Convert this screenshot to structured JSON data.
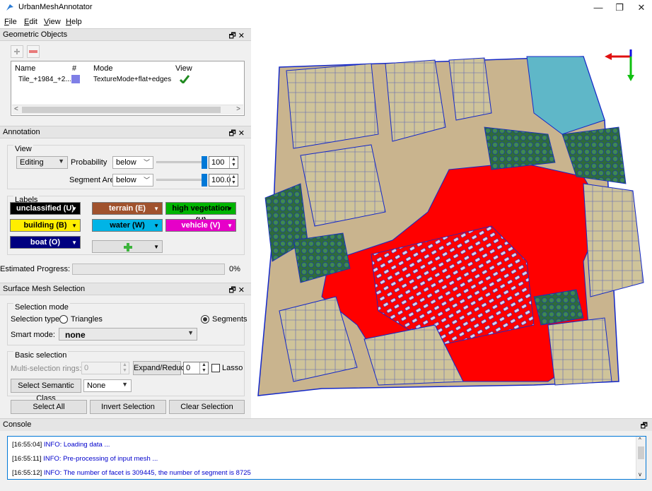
{
  "app": {
    "title": "UrbanMeshAnnotator"
  },
  "window_buttons": {
    "minimize": "—",
    "restore": "❐",
    "close": "✕"
  },
  "menu": [
    {
      "key": "F",
      "rest": "ile"
    },
    {
      "key": "E",
      "rest": "dit"
    },
    {
      "key": "V",
      "rest": "iew"
    },
    {
      "key": "H",
      "rest": "elp"
    }
  ],
  "dock_buttons": "🗗✕",
  "geometric_objects": {
    "title": "Geometric Objects",
    "columns": [
      "Name",
      "#",
      "Mode",
      "View"
    ],
    "row": {
      "name": "Tile_+1984_+2...",
      "color": "#7f7fe6",
      "mode": "TextureMode+flat+edges",
      "view_icon": "checkmark-icon"
    },
    "scroll_left": "<",
    "scroll_right": ">"
  },
  "annotation": {
    "title": "Annotation",
    "view_group": "View",
    "mode": "Editing",
    "probability_label": "Probability",
    "probability_op": "below",
    "probability_value": "100",
    "probability_slider": 1.0,
    "segment_area_label": "Segment Area",
    "segment_area_op": "below",
    "segment_area_value": "100.0",
    "segment_area_slider": 1.0,
    "labels_group": "Labels",
    "labels": [
      {
        "text": "unclassified (U)",
        "bg": "#000000",
        "fg": "#ffffff"
      },
      {
        "text": "terrain (E)",
        "bg": "#a0522d",
        "fg": "#ffffff"
      },
      {
        "text": "high vegetation (H)",
        "bg": "#00b400",
        "fg": "#000000"
      },
      {
        "text": "building (B)",
        "bg": "#ffee00",
        "fg": "#000000"
      },
      {
        "text": "water (W)",
        "bg": "#00b4e6",
        "fg": "#000000"
      },
      {
        "text": "vehicle (V)",
        "bg": "#e600c8",
        "fg": "#ffffff"
      },
      {
        "text": "boat (O)",
        "bg": "#000080",
        "fg": "#ffffff"
      }
    ],
    "add_label_icon": "plus-icon",
    "progress_label": "Estimated Progress:",
    "progress_value": 0,
    "progress_text": "0%"
  },
  "surface_selection": {
    "title": "Surface Mesh Selection",
    "selection_mode_group": "Selection mode",
    "selection_type_label": "Selection type:",
    "triangles": "Triangles",
    "segments": "Segments",
    "smart_mode_label": "Smart mode:",
    "smart_mode_value": "none",
    "basic_group": "Basic selection",
    "multi_rings_label": "Multi-selection rings:",
    "multi_rings_value": "0",
    "expand_reduce": "Expand/Reduce",
    "expand_value": "0",
    "lasso": "Lasso",
    "select_semantic_class": "Select Semantic Class",
    "semantic_value": "None",
    "select_all": "Select All",
    "select_all_mnemonic": "A",
    "invert_selection": "Invert Selection",
    "clear_selection": "Clear Selection"
  },
  "console": {
    "title": "Console",
    "lines": [
      {
        "ts": "[16:55:04]",
        "msg": " INFO: Loading data ..."
      },
      {
        "ts": "[16:55:11]",
        "msg": " INFO: Pre-processing of input mesh ..."
      },
      {
        "ts": "[16:55:12]",
        "msg": " INFO: The number of facet is 309445, the number of segment is 8725"
      }
    ]
  },
  "colors": {
    "accent": "#0078d7",
    "ground_red": "#ff0000",
    "edge_blue": "#1428c8",
    "water": "#5fb7c8",
    "tree": "#2e6b3c",
    "roof": "#cfc49a"
  }
}
